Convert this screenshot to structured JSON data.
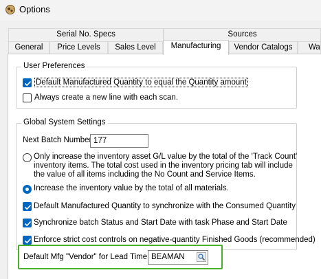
{
  "window": {
    "title": "Options",
    "app_icon": "options-app-icon"
  },
  "tabs": {
    "row_back": [
      "Serial No. Specs",
      "Sources"
    ],
    "row_front": [
      "General",
      "Price Levels",
      "Sales Level",
      "Manufacturing",
      "Vendor Catalogs",
      "Wa"
    ],
    "active": "Manufacturing"
  },
  "user_prefs": {
    "title": "User Preferences",
    "default_qty_label": "Default Manufactured Quantity to equal the Quantity amount",
    "default_qty_checked": true,
    "new_line_label": "Always create a new line with each scan.",
    "new_line_checked": false
  },
  "global": {
    "title": "Global System Settings",
    "next_batch_label": "Next Batch Number:",
    "next_batch_value": "177",
    "radio_only_line1": "Only increase the inventory asset G/L value by the total of the 'Track Count'",
    "radio_only_line2": "inventory items.  The total cost used in the inventory pricing tab will include",
    "radio_only_line3": "the value of all items including the No Count and Service Items.",
    "radio_only_selected": false,
    "radio_all_label": "Increase the inventory value by the total of all materials.",
    "radio_all_selected": true,
    "sync_consumed_label": "Default Manufactured Quantity to synchronize with the Consumed Quantity",
    "sync_consumed_checked": true,
    "sync_batch_label": "Synchronize batch Status and Start Date with task Phase and Start Date",
    "sync_batch_checked": true,
    "strict_cost_label": "Enforce strict cost controls on negative-quantity Finished Goods (recommended)",
    "strict_cost_checked": true,
    "vendor_label": "Default Mfg \"Vendor\" for Lead Time:",
    "vendor_value": "BEAMAN"
  },
  "colors": {
    "accent": "#0067c0",
    "highlight": "#4caf2a"
  }
}
